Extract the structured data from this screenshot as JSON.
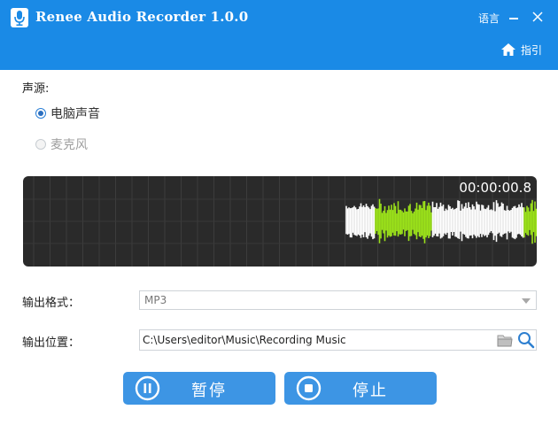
{
  "window": {
    "title": "Renee Audio Recorder 1.0.0",
    "language_label": "语言",
    "guide_label": "指引"
  },
  "source": {
    "label": "声源:",
    "options": [
      {
        "label": "电脑声音",
        "selected": true,
        "enabled": true
      },
      {
        "label": "麦克风",
        "selected": false,
        "enabled": false
      }
    ]
  },
  "recording": {
    "elapsed_time": "00:00:00.8"
  },
  "output": {
    "format_label": "输出格式：",
    "format_value": "MP3",
    "location_label": "输出位置：",
    "location_value": "C:\\Users\\editor\\Music\\Recording Music"
  },
  "buttons": {
    "pause_label": "暂停",
    "stop_label": "停止"
  },
  "colors": {
    "title_bar": "#1a8ae6",
    "button": "#3d95e4",
    "wave_panel": "#2a2a2a",
    "wave_white": "#ffffff",
    "wave_green": "#9be21a"
  }
}
